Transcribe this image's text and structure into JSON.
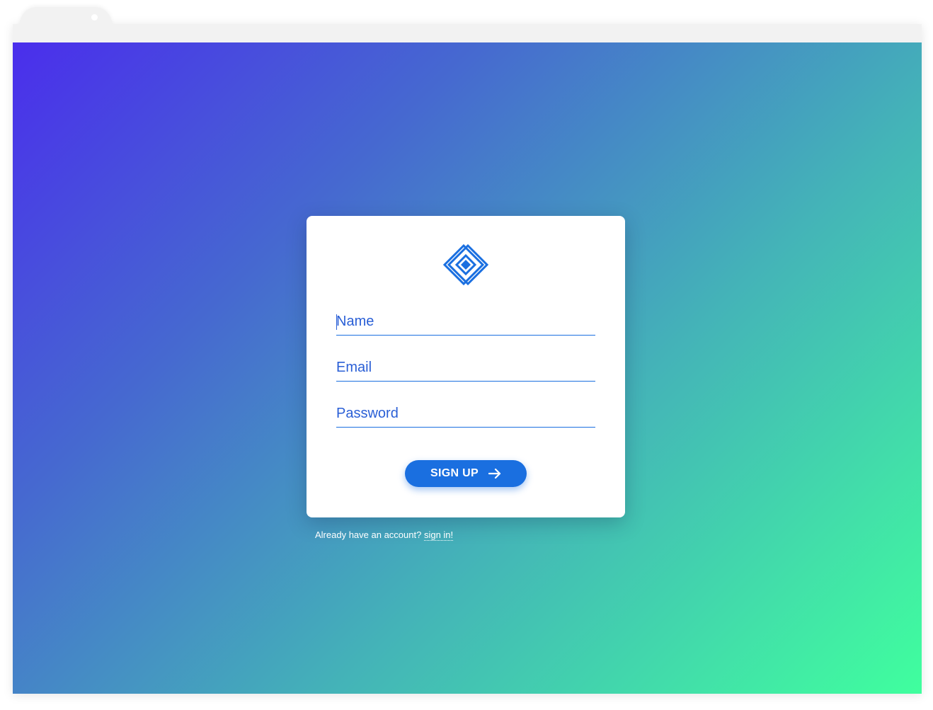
{
  "form": {
    "name_placeholder": "Name",
    "email_placeholder": "Email",
    "password_placeholder": "Password",
    "submit_label": "SIGN UP"
  },
  "footer": {
    "prompt": "Already have an account?",
    "link_label": "sign in!"
  },
  "icons": {
    "logo": "diamond-logo-icon",
    "submit": "arrow-right-icon"
  },
  "colors": {
    "accent": "#1a6fe0",
    "gradient_start": "#4a2eec",
    "gradient_end": "#40ff9e"
  }
}
